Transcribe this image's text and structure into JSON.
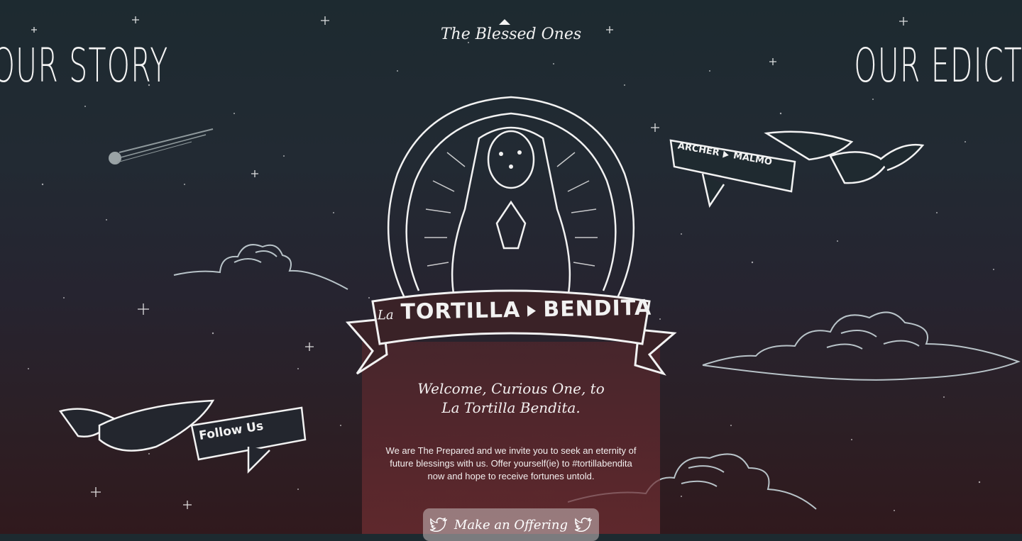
{
  "nav": {
    "left_label": "OUR STORY",
    "left_arrow": "←",
    "right_label": "OUR EDICT",
    "right_arrow": "→"
  },
  "header": {
    "title": "The Blessed Ones"
  },
  "logo": {
    "prefix": "La",
    "word1": "TORTILLA",
    "word2": "BENDITA"
  },
  "banners": {
    "credit_left": "ARCHER",
    "credit_right": "MALMO",
    "follow": "Follow Us"
  },
  "welcome": {
    "line1": "Welcome, Curious One, to",
    "line2": "La Tortilla Bendita."
  },
  "intro": "We are The Prepared and we invite you to seek an eternity of future blessings with us. Offer yourself(ie) to #tortillabendita now and hope to receive fortunes untold.",
  "cta": {
    "label": "Make an Offering",
    "icon": "twitter-bird-icon"
  },
  "colors": {
    "sky_top": "#1d2a30",
    "sky_bottom": "#30191d",
    "panel": "#5f282d",
    "line_art": "#f3f3f3",
    "cloud": "#b8c3c8"
  }
}
